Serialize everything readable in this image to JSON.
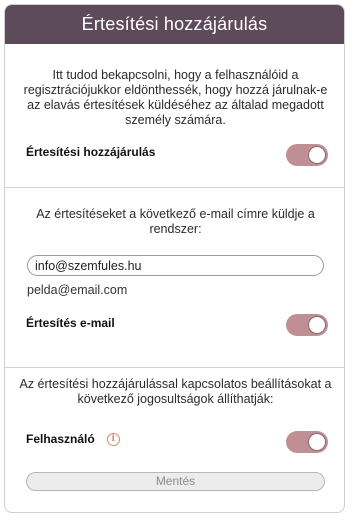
{
  "header": {
    "title": "Értesítési hozzájárulás"
  },
  "consent_section": {
    "description": "Itt tudod bekapcsolni, hogy a felhasználóid a regisztrációjukkor eldönthessék, hogy hozzá járulnak-e az elavás értesítések küldéséhez az általad megadott személy számára.",
    "toggle_label": "Értesítési hozzájárulás",
    "toggle_on": true
  },
  "email_section": {
    "description": "Az értesítéseket a következő e-mail címre küldje a rendszer:",
    "email_value": "info@szemfules.hu",
    "email_example": "pelda@email.com",
    "toggle_label": "Értesítés e-mail",
    "toggle_on": true
  },
  "permission_section": {
    "description": "Az értesítési hozzájárulással kapcsolatos beállításokat a következő jogosultságok állíthatják:",
    "toggle_label": "Felhasználó",
    "info_icon": "i",
    "toggle_on": true
  },
  "save_button": {
    "label": "Mentés"
  },
  "colors": {
    "header_bg": "#5d4a5a",
    "toggle_on": "#c08f94",
    "info_accent": "#d98770"
  }
}
